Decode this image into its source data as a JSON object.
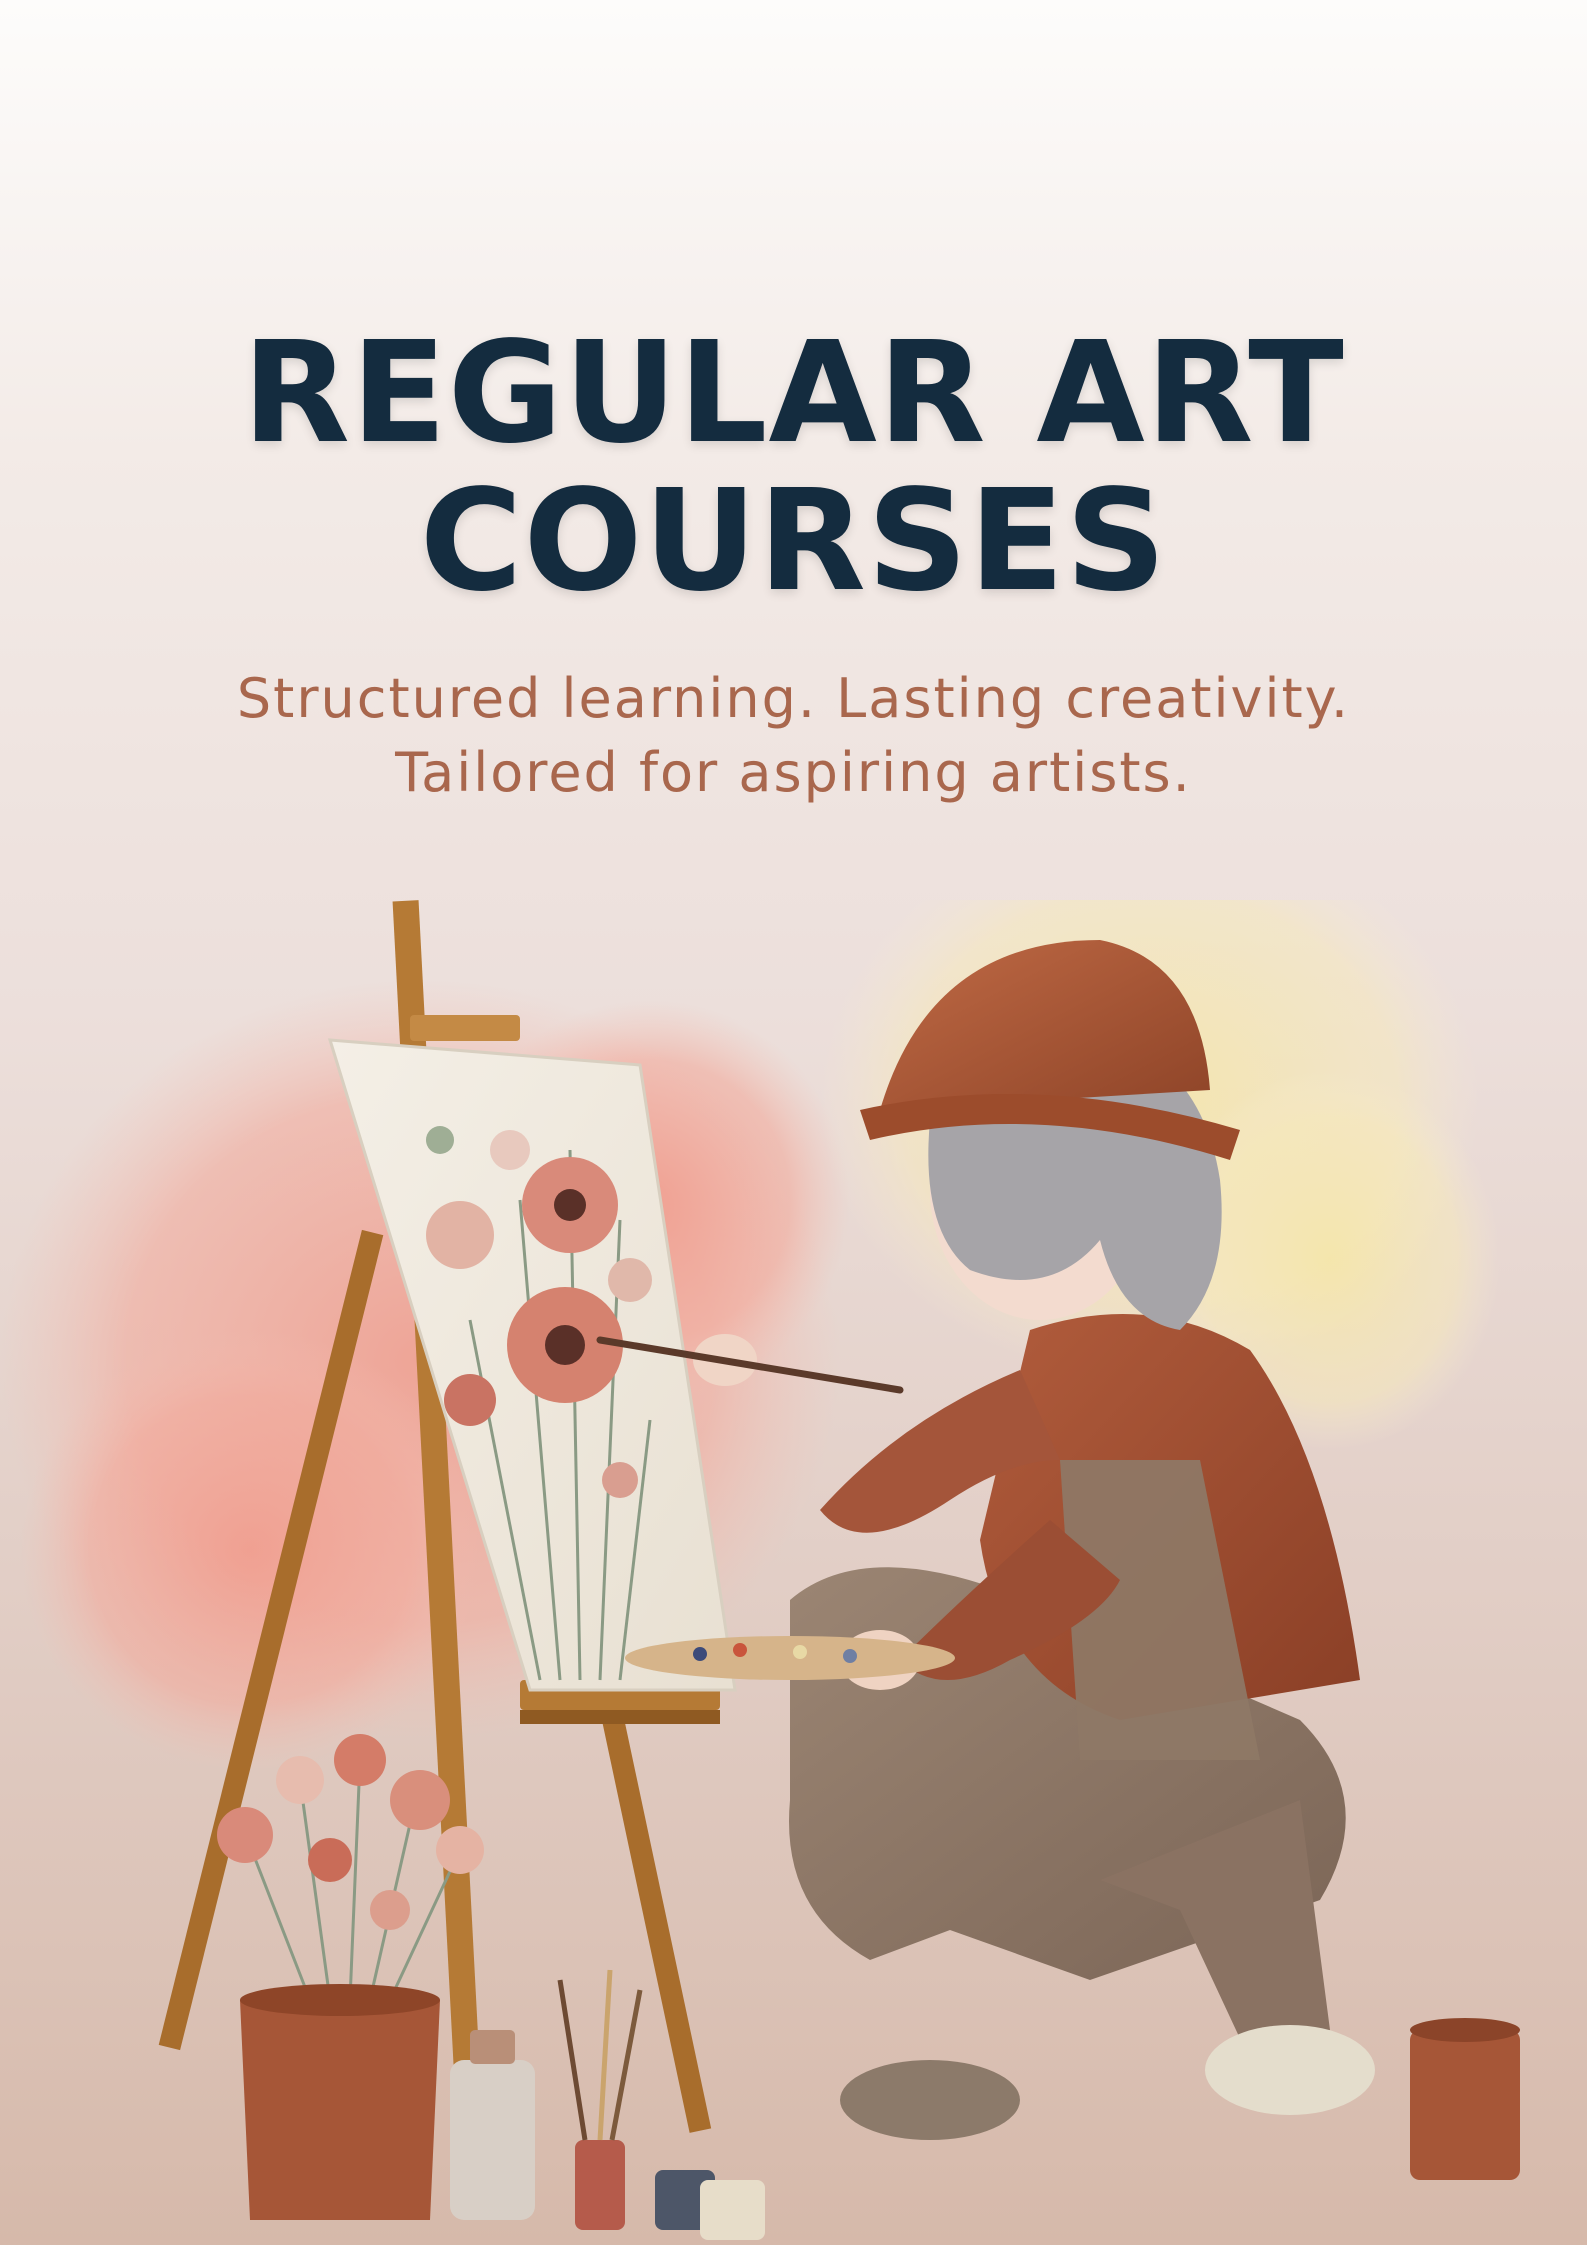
{
  "header": {
    "title_line1": "REGULAR ART",
    "title_line2": "COURSES"
  },
  "tagline": {
    "line1": "Structured learning. Lasting creativity.",
    "line2": "Tailored for aspiring artists."
  },
  "colors": {
    "title": "#142c3f",
    "subtitle": "#a9674d",
    "pink_splash": "#f0a79a",
    "yellow_splash": "#f4e2a4",
    "terracotta": "#a65637",
    "easel_wood": "#b57a35"
  },
  "illustration": {
    "subject": "woman-painting-flowers-on-easel",
    "icons": [
      "easel-icon",
      "painter-figure-icon",
      "flower-pot-icon",
      "paint-jars-icon",
      "palette-icon"
    ]
  }
}
